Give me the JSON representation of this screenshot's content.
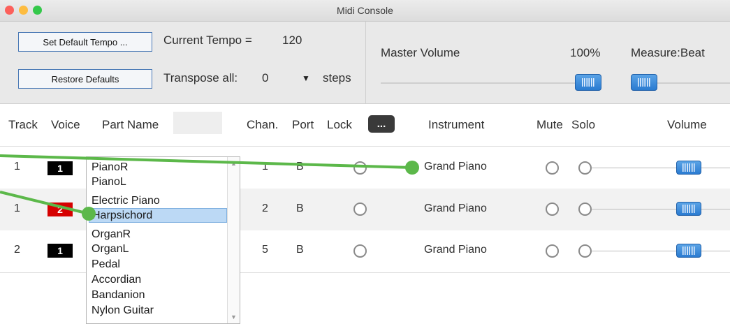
{
  "window": {
    "title": "Midi Console",
    "traffic_lights": [
      "#fc605b",
      "#fdbc40",
      "#34c84a"
    ]
  },
  "toolbar": {
    "set_default_tempo": "Set Default Tempo ...",
    "current_tempo_label": "Current Tempo =",
    "current_tempo_value": "120",
    "restore_defaults": "Restore Defaults",
    "transpose_label": "Transpose all:",
    "transpose_value": "0",
    "transpose_arrow": "▼",
    "transpose_unit": "steps",
    "master_volume_label": "Master Volume",
    "master_volume_value": "100%",
    "measure_beat_label": "Measure:Beat"
  },
  "columns": {
    "track": "Track",
    "voice": "Voice",
    "part_name": "Part Name",
    "chan": "Chan.",
    "port": "Port",
    "lock": "Lock",
    "more_button": "...",
    "instrument": "Instrument",
    "mute": "Mute",
    "solo": "Solo",
    "volume": "Volume"
  },
  "rows": [
    {
      "track": "1",
      "voice": "1",
      "voice_color": "#000000",
      "chan": "1",
      "port": "B",
      "instrument": "Grand Piano"
    },
    {
      "track": "1",
      "voice": "2",
      "voice_color": "#d60000",
      "chan": "2",
      "port": "B",
      "instrument": "Grand Piano"
    },
    {
      "track": "2",
      "voice": "1",
      "voice_color": "#000000",
      "chan": "5",
      "port": "B",
      "instrument": "Grand Piano"
    }
  ],
  "part_dropdown": {
    "selected": "Harpsichord",
    "items": [
      "PianoR",
      "PianoL",
      "Electric Piano",
      "Harpsichord",
      "OrganR",
      "OrganL",
      "Pedal",
      "Accordian",
      "Bandanion",
      "Nylon Guitar"
    ]
  },
  "colors": {
    "annotation_green": "#5cb84a",
    "slider_blue": "#2a7bd1",
    "row_alt": "#f2f2f2"
  }
}
